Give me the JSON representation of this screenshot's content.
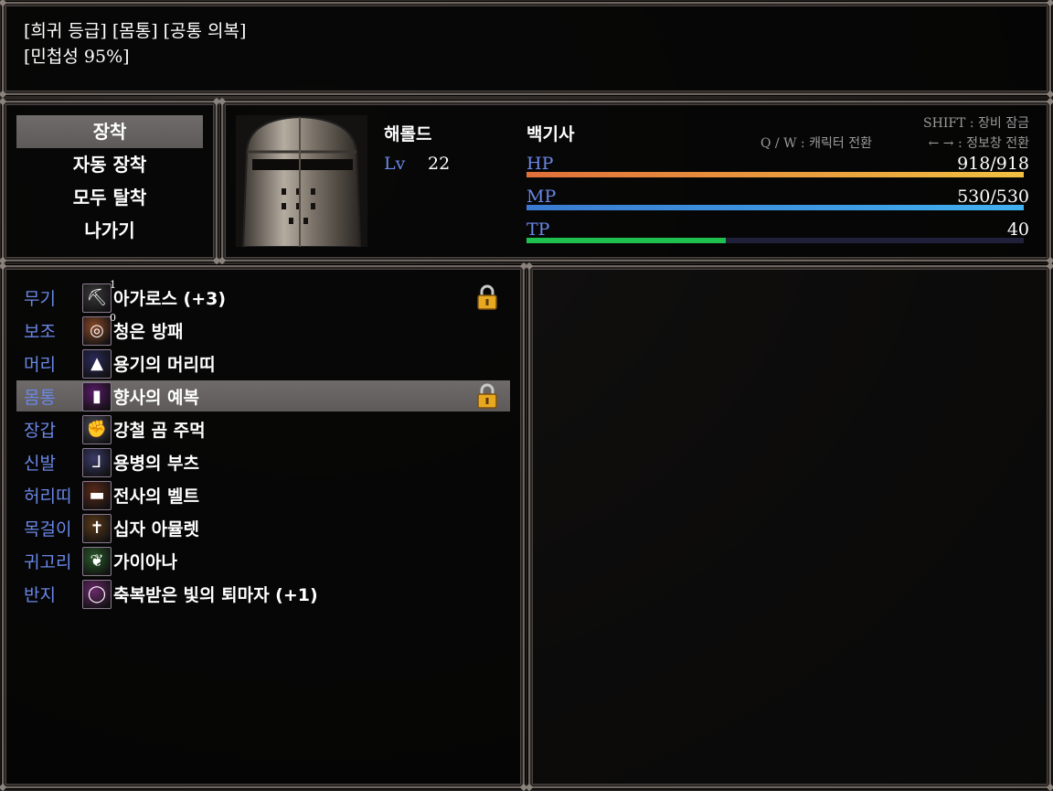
{
  "help": {
    "line1": "[희귀 등급] [몸통] [공통 의복]",
    "line2": "[민첩성 95%]"
  },
  "commands": [
    "장착",
    "자동 장착",
    "모두 탈착",
    "나가기"
  ],
  "actor": {
    "name": "해롤드",
    "level_label": "Lv",
    "level": "22",
    "class": "백기사",
    "hp_label": "HP",
    "hp_text": "918/918",
    "hp_ratio": 1.0,
    "mp_label": "MP",
    "mp_text": "530/530",
    "mp_ratio": 1.0,
    "tp_label": "TP",
    "tp_text": "40",
    "tp_ratio": 0.4
  },
  "hints": {
    "shift": "SHIFT : 장비 잠금",
    "qw": "Q / W : 캐릭터 전환",
    "arrows": "← → : 정보창 전환"
  },
  "equips": [
    {
      "slot": "무기",
      "name": "아가로스 (+3)",
      "icon": "pickaxe-icon",
      "glyph": "⛏",
      "color": "#3a3a3a",
      "locked": true,
      "badge": "1"
    },
    {
      "slot": "보조",
      "name": "청은 방패",
      "icon": "shield-icon",
      "glyph": "◎",
      "color": "#8a4a2a",
      "locked": false,
      "badge": "0"
    },
    {
      "slot": "머리",
      "name": "용기의 머리띠",
      "icon": "hood-icon",
      "glyph": "▲",
      "color": "#2a2a5a",
      "locked": false,
      "badge": ""
    },
    {
      "slot": "몸통",
      "name": "향사의 예복",
      "icon": "robe-icon",
      "glyph": "▮",
      "color": "#5a1a6a",
      "locked": true,
      "badge": ""
    },
    {
      "slot": "장갑",
      "name": "강철 곰 주먹",
      "icon": "gauntlet-icon",
      "glyph": "✊",
      "color": "#4a4a5a",
      "locked": false,
      "badge": ""
    },
    {
      "slot": "신발",
      "name": "용병의 부츠",
      "icon": "boots-icon",
      "glyph": "⅃",
      "color": "#3a3a6a",
      "locked": false,
      "badge": ""
    },
    {
      "slot": "허리띠",
      "name": "전사의 벨트",
      "icon": "belt-icon",
      "glyph": "▬",
      "color": "#5a2a1a",
      "locked": false,
      "badge": ""
    },
    {
      "slot": "목걸이",
      "name": "십자 아뮬렛",
      "icon": "amulet-icon",
      "glyph": "✝",
      "color": "#5a3a1a",
      "locked": false,
      "badge": ""
    },
    {
      "slot": "귀고리",
      "name": "가이아나",
      "icon": "earring-icon",
      "glyph": "❦",
      "color": "#2a5a2a",
      "locked": false,
      "badge": ""
    },
    {
      "slot": "반지",
      "name": "축복받은 빛의 퇴마자 (+1)",
      "icon": "ring-icon",
      "glyph": "◯",
      "color": "#6a2a6a",
      "locked": false,
      "badge": ""
    }
  ],
  "selected_index": 3,
  "colors": {
    "label_blue": "#6a87e6",
    "hp_from": "#e0703a",
    "hp_to": "#f0c040",
    "mp_from": "#3a7ad0",
    "mp_to": "#40b0f0",
    "tp_color": "#20c050",
    "gauge_bg": "#20203a"
  }
}
